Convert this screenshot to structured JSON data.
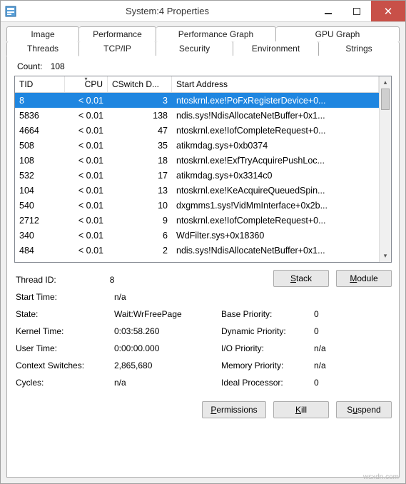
{
  "window": {
    "title": "System:4 Properties"
  },
  "tabs": {
    "row1": [
      "Image",
      "Performance",
      "Performance Graph",
      "GPU Graph"
    ],
    "row2": [
      "Threads",
      "TCP/IP",
      "Security",
      "Environment",
      "Strings"
    ],
    "active": "Threads"
  },
  "count": {
    "label": "Count:",
    "value": "108"
  },
  "columns": {
    "tid": "TID",
    "cpu": "CPU",
    "cswitch": "CSwitch D...",
    "start": "Start Address"
  },
  "rows": [
    {
      "tid": "8",
      "cpu": "< 0.01",
      "csw": "3",
      "start": "ntoskrnl.exe!PoFxRegisterDevice+0...",
      "selected": true
    },
    {
      "tid": "5836",
      "cpu": "< 0.01",
      "csw": "138",
      "start": "ndis.sys!NdisAllocateNetBuffer+0x1..."
    },
    {
      "tid": "4664",
      "cpu": "< 0.01",
      "csw": "47",
      "start": "ntoskrnl.exe!IofCompleteRequest+0..."
    },
    {
      "tid": "508",
      "cpu": "< 0.01",
      "csw": "35",
      "start": "atikmdag.sys+0xb0374"
    },
    {
      "tid": "108",
      "cpu": "< 0.01",
      "csw": "18",
      "start": "ntoskrnl.exe!ExfTryAcquirePushLoc..."
    },
    {
      "tid": "532",
      "cpu": "< 0.01",
      "csw": "17",
      "start": "atikmdag.sys+0x3314c0"
    },
    {
      "tid": "104",
      "cpu": "< 0.01",
      "csw": "13",
      "start": "ntoskrnl.exe!KeAcquireQueuedSpin..."
    },
    {
      "tid": "540",
      "cpu": "< 0.01",
      "csw": "10",
      "start": "dxgmms1.sys!VidMmInterface+0x2b..."
    },
    {
      "tid": "2712",
      "cpu": "< 0.01",
      "csw": "9",
      "start": "ntoskrnl.exe!IofCompleteRequest+0..."
    },
    {
      "tid": "340",
      "cpu": "< 0.01",
      "csw": "6",
      "start": "WdFilter.sys+0x18360"
    },
    {
      "tid": "484",
      "cpu": "< 0.01",
      "csw": "2",
      "start": "ndis.sys!NdisAllocateNetBuffer+0x1..."
    }
  ],
  "buttons": {
    "stack": "Stack",
    "module": "Module",
    "permissions": "Permissions",
    "kill": "Kill",
    "suspend": "Suspend"
  },
  "details": {
    "left": [
      {
        "label": "Thread ID:",
        "value": "8"
      },
      {
        "label": "Start Time:",
        "value": "n/a"
      },
      {
        "label": "State:",
        "value": "Wait:WrFreePage"
      },
      {
        "label": "Kernel Time:",
        "value": "0:03:58.260"
      },
      {
        "label": "User Time:",
        "value": "0:00:00.000"
      },
      {
        "label": "Context Switches:",
        "value": "2,865,680"
      },
      {
        "label": "Cycles:",
        "value": "n/a"
      }
    ],
    "right": [
      {
        "label": "Base Priority:",
        "value": "0"
      },
      {
        "label": "Dynamic Priority:",
        "value": "0"
      },
      {
        "label": "I/O Priority:",
        "value": "n/a"
      },
      {
        "label": "Memory Priority:",
        "value": "n/a"
      },
      {
        "label": "Ideal Processor:",
        "value": "0"
      }
    ]
  },
  "watermark": "wsxdn.com"
}
